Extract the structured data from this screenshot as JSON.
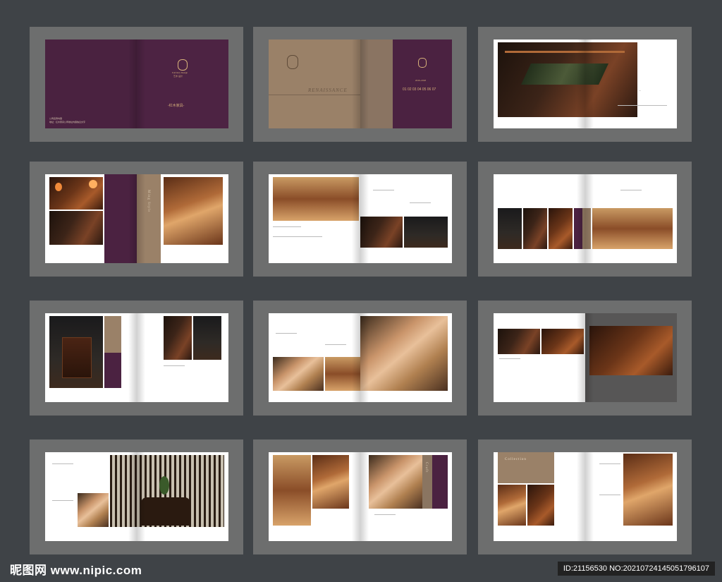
{
  "cover": {
    "brand_name": "Furniture Design",
    "brand_cn": "艺术·设计",
    "product_line": "-红木家具-",
    "left_notes": [
      "公司名称内容",
      "地址：红木家具公司地址内容信息文字"
    ]
  },
  "spread2": {
    "word": "RENAISSANCE",
    "sub": "2016~2018",
    "numbers": "01 02 03 04 05 06 07"
  },
  "spread4": {
    "vertical_text": "Ming Style"
  },
  "spread12": {
    "vertical_text": "Collection"
  },
  "spread11": {
    "vertical_text": "Craft"
  },
  "watermark": {
    "site": "昵图网 www.nipic.com",
    "id": "ID:21156530 NO:20210724145051796107"
  },
  "colors": {
    "page_bg": "#3f4347",
    "frame": "#6d6e6e",
    "purple": "#4b2241",
    "tan": "#9a8168"
  }
}
